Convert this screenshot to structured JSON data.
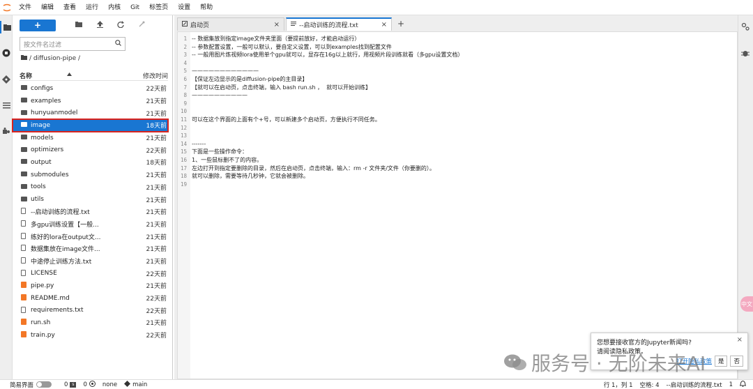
{
  "menubar": {
    "items": [
      "文件",
      "编辑",
      "查看",
      "运行",
      "内核",
      "Git",
      "标签页",
      "设置",
      "帮助"
    ]
  },
  "filebrowser": {
    "new_label": "+",
    "search_placeholder": "按文件名过滤",
    "breadcrumb": "/ diffusion-pipe /",
    "header_name": "名称",
    "header_time": "修改时间",
    "items": [
      {
        "name": "configs",
        "time": "22天前",
        "type": "folder"
      },
      {
        "name": "examples",
        "time": "21天前",
        "type": "folder"
      },
      {
        "name": "hunyuanmodel",
        "time": "21天前",
        "type": "folder"
      },
      {
        "name": "image",
        "time": "18天前",
        "type": "folder",
        "selected": true
      },
      {
        "name": "models",
        "time": "21天前",
        "type": "folder"
      },
      {
        "name": "optimizers",
        "time": "22天前",
        "type": "folder"
      },
      {
        "name": "output",
        "time": "18天前",
        "type": "folder"
      },
      {
        "name": "submodules",
        "time": "21天前",
        "type": "folder"
      },
      {
        "name": "tools",
        "time": "21天前",
        "type": "folder"
      },
      {
        "name": "utils",
        "time": "21天前",
        "type": "folder"
      },
      {
        "name": "--启动训练的流程.txt",
        "time": "21天前",
        "type": "file"
      },
      {
        "name": "多gpu训练设置【一般...",
        "time": "21天前",
        "type": "file"
      },
      {
        "name": "练好的lora在output文...",
        "time": "21天前",
        "type": "file"
      },
      {
        "name": "数据集放在image文件...",
        "time": "21天前",
        "type": "file"
      },
      {
        "name": "中途停止训练方法.txt",
        "time": "21天前",
        "type": "file"
      },
      {
        "name": "LICENSE",
        "time": "22天前",
        "type": "file"
      },
      {
        "name": "pipe.py",
        "time": "21天前",
        "type": "py"
      },
      {
        "name": "README.md",
        "time": "22天前",
        "type": "md"
      },
      {
        "name": "requirements.txt",
        "time": "22天前",
        "type": "file"
      },
      {
        "name": "run.sh",
        "time": "21天前",
        "type": "sh"
      },
      {
        "name": "train.py",
        "time": "22天前",
        "type": "py"
      }
    ]
  },
  "tabs": {
    "launcher": "启动页",
    "file": "--启动训练的流程.txt",
    "close": "×",
    "add": "+"
  },
  "editor": {
    "lines": [
      "-- 数据集放到指定image文件夹里面（要提前放好，才能启动运行）",
      "-- 参数配置设置，一般可以默认，要自定义设置，可以到examples找到配置文件",
      "-- 一般用图片炼视频lora使用单个gpu就可以，显存在16g以上就行，用视频片段训练就看（多gpu设置文档）",
      "",
      "————————————",
      "【保证左边显示的是diffusion-pipe的主目录】",
      "【就可以在启动页，点击终端，输入 bash run.sh ，  就可以开始训练】",
      "——————————",
      "",
      "",
      "可以在这个界面的上面有个+号，可以新建多个启动页，方便执行不同任务。",
      "",
      "",
      "-------",
      "下面是一些操作命令：",
      "1、一些鼠标删不了的内容。",
      "左边打开到指定要删除的目录，然后在启动页，点击终端，输入：rm -r 文件夹/文件（你要删的）。",
      "就可以删除，需要等待几秒钟，它就会被删除。",
      ""
    ]
  },
  "statusbar": {
    "simple_label": "简易界面",
    "count1": "0",
    "box_label": "s",
    "count2": "0",
    "kernel": "none",
    "branch": "main",
    "position": "行 1，列 1",
    "spaces": "空格: 4",
    "filename": "--启动训练的流程.txt",
    "notif_count": "1"
  },
  "notification": {
    "line1": "您想要接收官方的Jupyter新闻吗?",
    "line2": "请阅读隐私政策。",
    "link": "打开隐私政策",
    "yes": "是",
    "no": "否",
    "close": "×"
  },
  "watermark": {
    "text": "服务号 · 无阶未来AI"
  },
  "side_badge": "中文",
  "colors": {
    "accent": "#1976d2",
    "highlight_border": "#d9231d",
    "jupyter_orange": "#f37726"
  }
}
